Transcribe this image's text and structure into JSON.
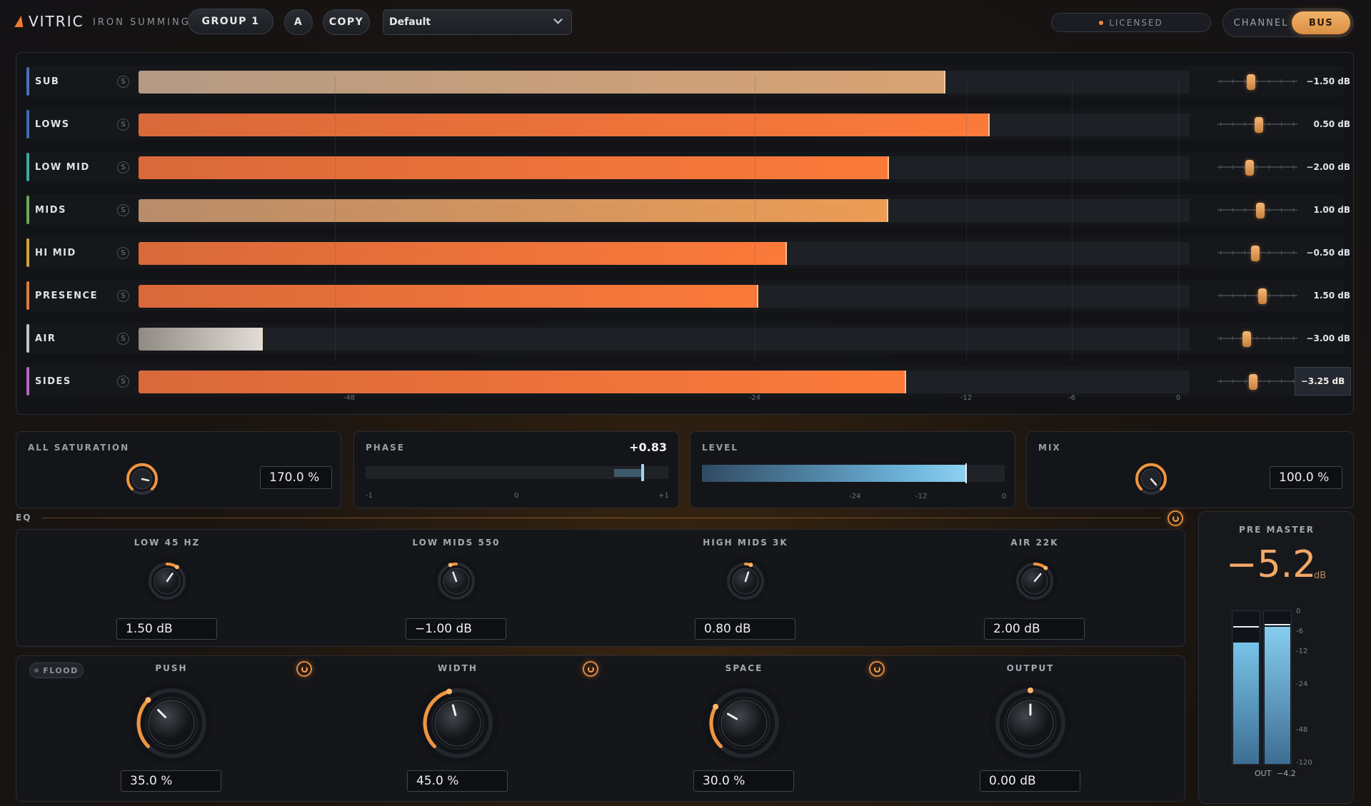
{
  "header": {
    "brand": "VITRIC",
    "product": "IRON SUMMING",
    "group_label": "GROUP 1",
    "ab_label": "A",
    "copy_label": "COPY",
    "preset": "Default",
    "license_label": "LICENSED",
    "mode_channel": "CHANNEL",
    "mode_bus": "BUS"
  },
  "bands": [
    {
      "name": "SUB",
      "level": 0.768,
      "value": "−1.50 dB",
      "accent": "#4a6fb5",
      "slider": 0.42
    },
    {
      "name": "LOWS",
      "level": 0.81,
      "value": "0.50 dB",
      "accent": "#3d6ab8",
      "slider": 0.52
    },
    {
      "name": "LOW MID",
      "level": 0.714,
      "value": "−2.00 dB",
      "accent": "#3aa9a0",
      "slider": 0.4
    },
    {
      "name": "MIDS",
      "level": 0.713,
      "value": "1.00 dB",
      "accent": "#6ea855",
      "slider": 0.54
    },
    {
      "name": "HI MID",
      "level": 0.617,
      "value": "−0.50 dB",
      "accent": "#d3a142",
      "slider": 0.47
    },
    {
      "name": "PRESENCE",
      "level": 0.59,
      "value": "1.50 dB",
      "accent": "#dd7a42",
      "slider": 0.56
    },
    {
      "name": "AIR",
      "level": 0.118,
      "value": "−3.00 dB",
      "accent": "#bfc4cc",
      "slider": 0.37
    },
    {
      "name": "SIDES",
      "level": 0.73,
      "value": "−3.25 dB",
      "accent": "#b366c4",
      "slider": 0.45
    }
  ],
  "band_scale": [
    "-48",
    "-24",
    "-12",
    "-6",
    "0"
  ],
  "all_saturation": {
    "label": "ALL SATURATION",
    "value": "170.0 %"
  },
  "phase": {
    "label": "PHASE",
    "value": "+0.83",
    "ticks": [
      "-1",
      "0",
      "+1"
    ]
  },
  "level": {
    "label": "LEVEL",
    "ticks": [
      "-24",
      "-12",
      "0"
    ]
  },
  "mix": {
    "label": "MIX",
    "value": "100.0 %"
  },
  "eq": {
    "label": "EQ",
    "bands": [
      {
        "label": "LOW 45 HZ",
        "value": "1.50 dB"
      },
      {
        "label": "LOW MIDS 550",
        "value": "−1.00 dB"
      },
      {
        "label": "HIGH MIDS 3K",
        "value": "0.80 dB"
      },
      {
        "label": "AIR 22K",
        "value": "2.00 dB"
      }
    ]
  },
  "flood_label": "FLOOD",
  "macros": [
    {
      "label": "PUSH",
      "value": "35.0 %"
    },
    {
      "label": "WIDTH",
      "value": "45.0 %"
    },
    {
      "label": "SPACE",
      "value": "30.0 %"
    },
    {
      "label": "OUTPUT",
      "value": "0.00 dB"
    }
  ],
  "pre_master": {
    "label": "PRE MASTER",
    "value": "−5.2",
    "unit": "dB",
    "scale": [
      "0",
      "-6",
      "-12",
      "-24",
      "-48",
      "-120"
    ],
    "out_label": "OUT",
    "out_value": "−4.2"
  },
  "colors": {
    "accent": "#f0883e",
    "meter_blue": "#6fb7de"
  }
}
